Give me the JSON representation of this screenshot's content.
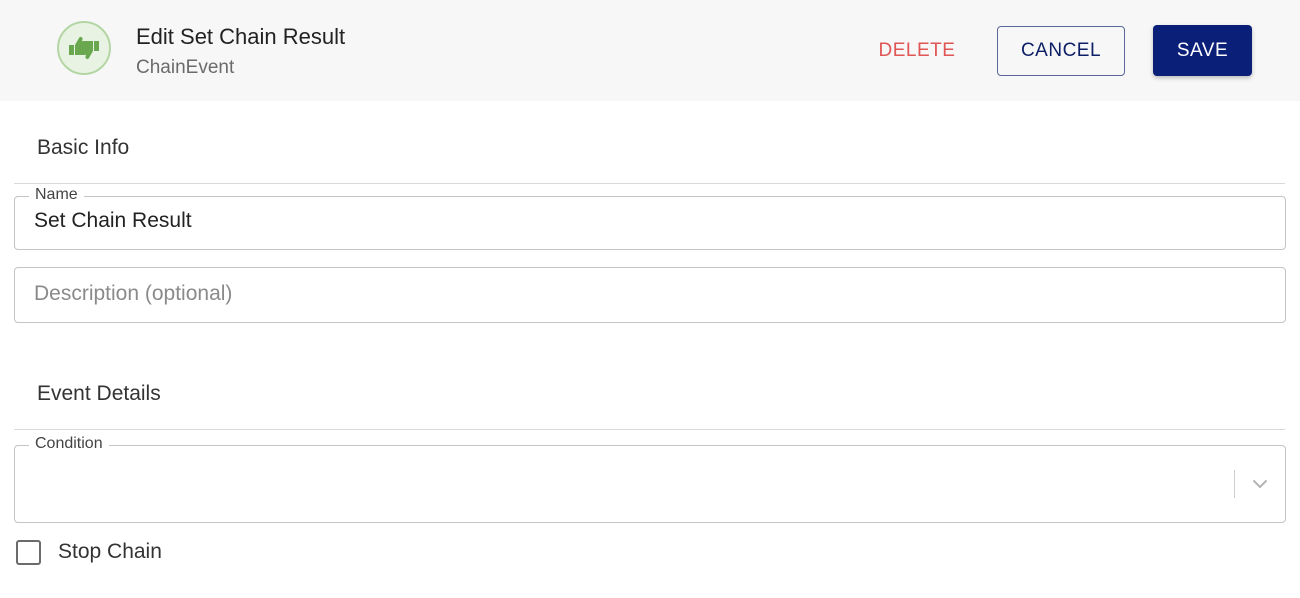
{
  "header": {
    "title": "Edit Set Chain Result",
    "subtitle": "ChainEvent",
    "icon": "thumbs-up-down-icon",
    "icon_color": "#6aa84f"
  },
  "actions": {
    "delete_label": "DELETE",
    "cancel_label": "CANCEL",
    "save_label": "SAVE"
  },
  "basic_info": {
    "section_title": "Basic Info",
    "name": {
      "label": "Name",
      "value": "Set Chain Result"
    },
    "description": {
      "placeholder": "Description (optional)",
      "value": ""
    }
  },
  "event_details": {
    "section_title": "Event Details",
    "condition": {
      "label": "Condition",
      "value": ""
    },
    "stop_chain": {
      "label": "Stop Chain",
      "checked": false
    }
  },
  "colors": {
    "primary": "#0a1f78",
    "danger": "#e05555"
  }
}
